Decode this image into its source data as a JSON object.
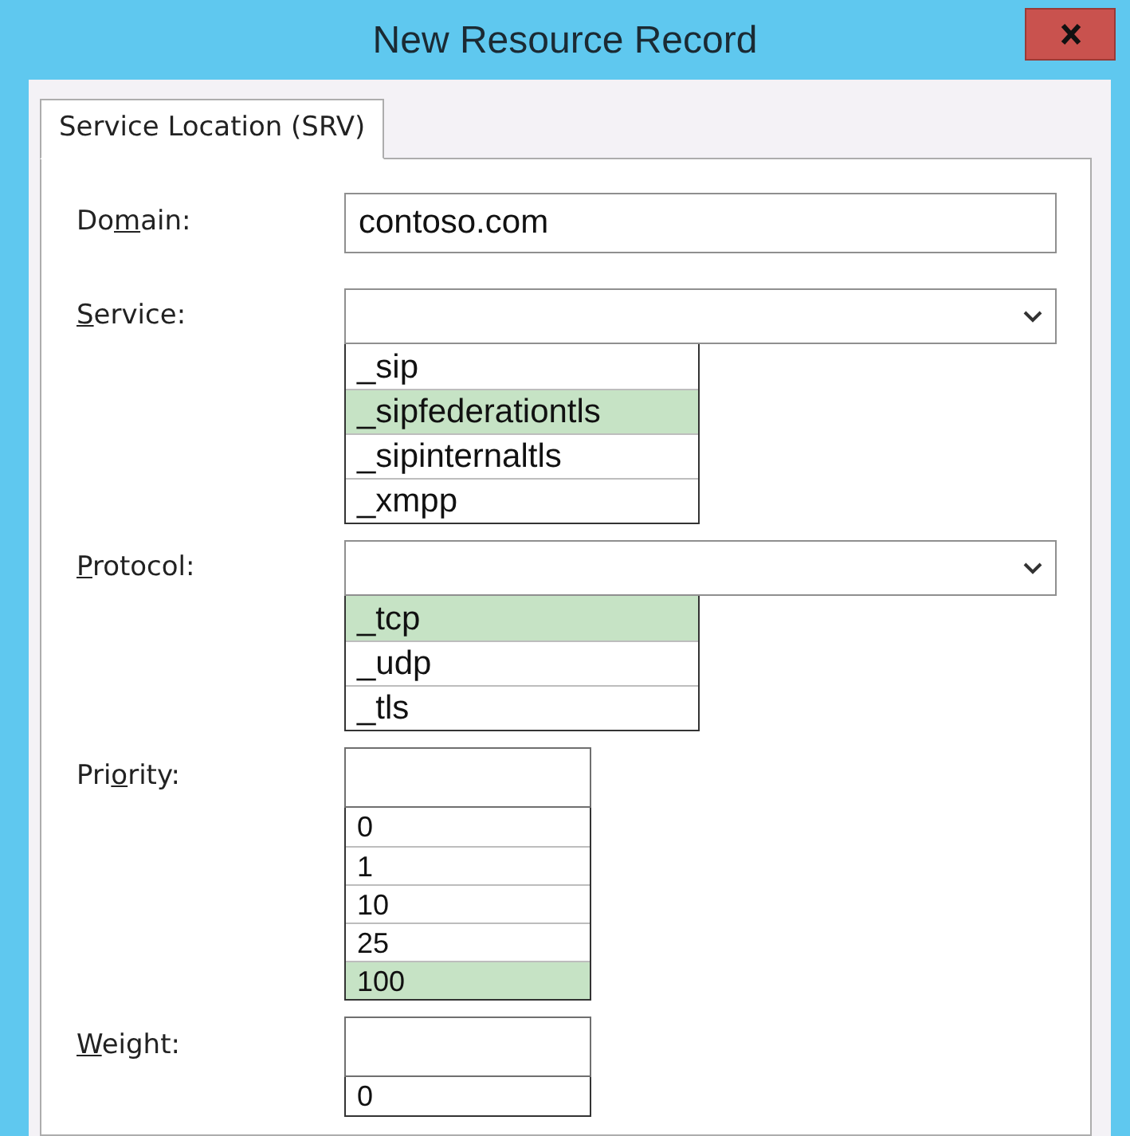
{
  "window": {
    "title": "New Resource Record"
  },
  "tabs": [
    {
      "label": "Service Location (SRV)",
      "selected": true
    }
  ],
  "fields": [
    {
      "kind": "text",
      "label": {
        "before": "Do",
        "key": "m",
        "after": "ain:"
      },
      "value": "contoso.com"
    },
    {
      "kind": "combo",
      "label": {
        "key": "S",
        "after": "ervice:"
      },
      "options": [
        {
          "text": "_sip",
          "selected": false
        },
        {
          "text": "_sipfederationtls",
          "selected": true
        },
        {
          "text": "_sipinternaltls",
          "selected": false
        },
        {
          "text": "_xmpp",
          "selected": false
        }
      ]
    },
    {
      "kind": "combo",
      "label": {
        "key": "P",
        "after": "rotocol:"
      },
      "options": [
        {
          "text": "_tcp",
          "selected": true
        },
        {
          "text": "_udp",
          "selected": false
        },
        {
          "text": "_tls",
          "selected": false
        }
      ]
    },
    {
      "kind": "spin",
      "label": {
        "before": "Pri",
        "key": "o",
        "after": "rity:"
      },
      "options": [
        {
          "text": "0",
          "selected": false
        },
        {
          "text": "1",
          "selected": false
        },
        {
          "text": "10",
          "selected": false
        },
        {
          "text": "25",
          "selected": false
        },
        {
          "text": "100",
          "selected": true
        }
      ]
    },
    {
      "kind": "spin",
      "label": {
        "key": "W",
        "after": "eight:"
      },
      "options": [
        {
          "text": "0",
          "selected": false
        }
      ]
    }
  ]
}
